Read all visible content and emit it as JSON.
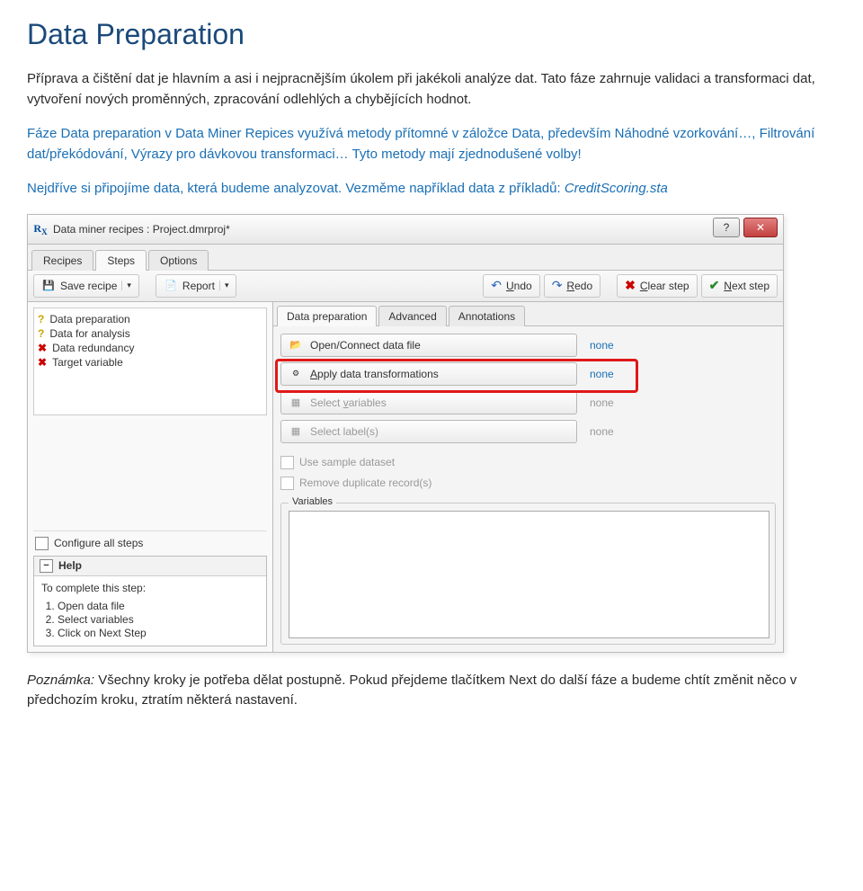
{
  "page": {
    "title": "Data Preparation",
    "para1": "Příprava a čištění dat je hlavním a asi i nejpracnějším úkolem při jakékoli analýze dat. Tato fáze zahrnuje validaci a transformaci dat, vytvoření nových proměnných, zpracování odlehlých a chybějících hodnot.",
    "para2_prefix": "Fáze ",
    "para2_span1": "Data preparation",
    "para2_mid1": " v Data Miner Repices využívá metody přítomné v záložce ",
    "para2_span2": "Data",
    "para2_mid2": ", především ",
    "para2_span3": "Náhodné vzorkování…",
    "para2_mid3": ", ",
    "para2_span4": "Filtrování dat/překódování",
    "para2_mid4": ", ",
    "para2_span5": "Výrazy pro dávkovou transformaci…",
    "para2_end": " Tyto metody mají zjednodušené volby!",
    "para3_a": "Nejdříve si připojíme data, která budeme analyzovat. Vezměme například data z příkladů: ",
    "para3_b": "CreditScoring.sta",
    "footnote_label": "Poznámka:",
    "footnote_text": " Všechny kroky je potřeba dělat postupně. Pokud přejdeme tlačítkem Next do další fáze a budeme chtít změnit něco v předchozím kroku, ztratím některá nastavení."
  },
  "win": {
    "title": "Data miner recipes : Project.dmrproj*",
    "help": "?",
    "close": "✕"
  },
  "topTabs": [
    "Recipes",
    "Steps",
    "Options"
  ],
  "toolbar": {
    "save": "Save recipe",
    "report": "Report",
    "undo": "Undo",
    "redo": "Redo",
    "clear": "Clear step",
    "next": "Next step"
  },
  "tree": {
    "items": [
      {
        "icon": "?",
        "label": "Data preparation"
      },
      {
        "icon": "?",
        "label": "Data for analysis"
      },
      {
        "icon": "X",
        "label": "Data redundancy"
      },
      {
        "icon": "X",
        "label": "Target variable"
      }
    ]
  },
  "configure": "Configure all steps",
  "help": {
    "title": "Help",
    "lead": "To complete this step:",
    "items": [
      "Open data file",
      "Select variables",
      "Click on Next Step"
    ]
  },
  "innerTabs": [
    "Data preparation",
    "Advanced",
    "Annotations"
  ],
  "right": {
    "open": "Open/Connect data file",
    "apply": "Apply data transformations",
    "selectVars": "Select variables",
    "selectLabels": "Select label(s)",
    "none": "none",
    "useSample": "Use sample dataset",
    "removeDup": "Remove duplicate record(s)",
    "variables": "Variables"
  }
}
